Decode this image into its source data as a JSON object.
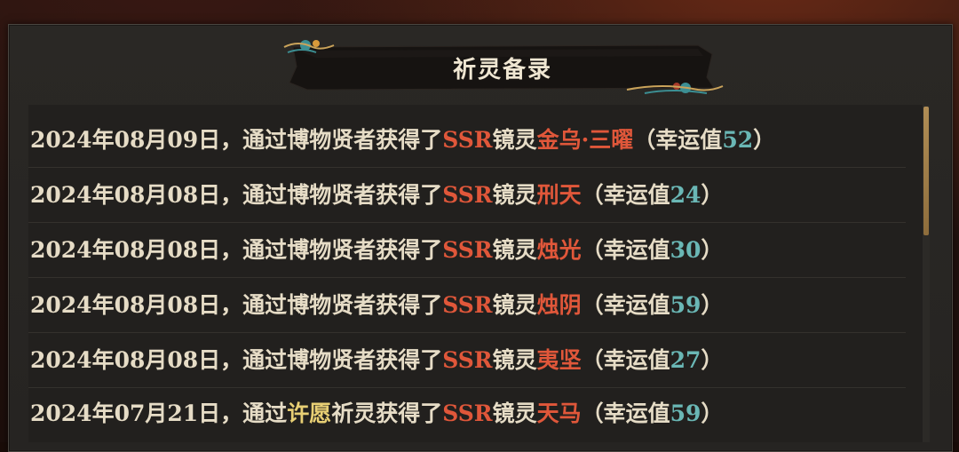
{
  "dialog": {
    "title": "祈灵备录"
  },
  "records": [
    {
      "date": "2024年08月09日，",
      "prefix": "通过",
      "source": "博物贤者",
      "suffix": "获得了",
      "rarity": "SSR",
      "kind": "镜灵",
      "name": "金乌·三曜",
      "luck_prefix": "（幸运值",
      "luck": "52",
      "luck_suffix": "）"
    },
    {
      "date": "2024年08月08日，",
      "prefix": "通过",
      "source": "博物贤者",
      "suffix": "获得了",
      "rarity": "SSR",
      "kind": "镜灵",
      "name": "刑天",
      "luck_prefix": "（幸运值",
      "luck": "24",
      "luck_suffix": "）"
    },
    {
      "date": "2024年08月08日，",
      "prefix": "通过",
      "source": "博物贤者",
      "suffix": "获得了",
      "rarity": "SSR",
      "kind": "镜灵",
      "name": "烛光",
      "luck_prefix": "（幸运值",
      "luck": "30",
      "luck_suffix": "）"
    },
    {
      "date": "2024年08月08日，",
      "prefix": "通过",
      "source": "博物贤者",
      "suffix": "获得了",
      "rarity": "SSR",
      "kind": "镜灵",
      "name": "烛阴",
      "luck_prefix": "（幸运值",
      "luck": "59",
      "luck_suffix": "）"
    },
    {
      "date": "2024年08月08日，",
      "prefix": "通过",
      "source": "博物贤者",
      "suffix": "获得了",
      "rarity": "SSR",
      "kind": "镜灵",
      "name": "夷坚",
      "luck_prefix": "（幸运值",
      "luck": "27",
      "luck_suffix": "）"
    },
    {
      "date": "2024年07月21日，",
      "prefix": "通过",
      "source": "许愿",
      "source_highlight": true,
      "source_tail": "祈灵",
      "suffix": "获得了",
      "rarity": "SSR",
      "kind": "镜灵",
      "name": "天马",
      "luck_prefix": "（幸运值",
      "luck": "59",
      "luck_suffix": "）"
    }
  ],
  "colors": {
    "rarity": "#e0573a",
    "luck": "#6ab7b5",
    "highlight_source": "#e8cf74",
    "text": "#e6dcc6"
  },
  "icons": {
    "title_left_ornament": "cloud-ornament-icon",
    "title_right_ornament": "cloud-ornament-icon"
  }
}
